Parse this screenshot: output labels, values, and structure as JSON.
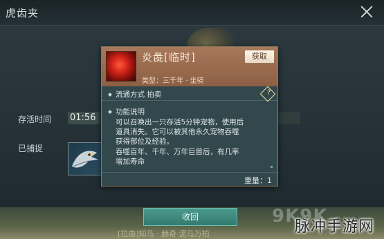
{
  "window": {
    "title": "虎齿夹"
  },
  "fields": {
    "survival_time_label": "存活时间",
    "survival_time_value": "01:56",
    "captured_label": "已捕捉"
  },
  "tooltip": {
    "name": "炎彘[临时]",
    "obtain_label": "获取",
    "type_text": "类型：三千年 · 坐骑",
    "circulation": "流通方式    拍卖",
    "help_glyph": "?",
    "function_title": "功能说明",
    "description_lines": [
      "可以召唤出一只存活5分钟宠物，使用后",
      "道具消失。它可以被其他永久宠物吞噬",
      "获得部位及经验。",
      "吞噬百年、千年、万年巨兽后，有几率",
      "增加寿命"
    ],
    "weight": "重量：1"
  },
  "actions": {
    "primary_label": "收回"
  },
  "bottom": {
    "text": "[拉曲]知马 · 赫奇·泥马万柏"
  },
  "watermark": {
    "k_text": "9K9K",
    "brand": "脉冲手游网"
  },
  "icons": [
    "close-icon",
    "item-flame-icon",
    "bird-icon",
    "help-icon",
    "diamond-bullet-icon"
  ]
}
